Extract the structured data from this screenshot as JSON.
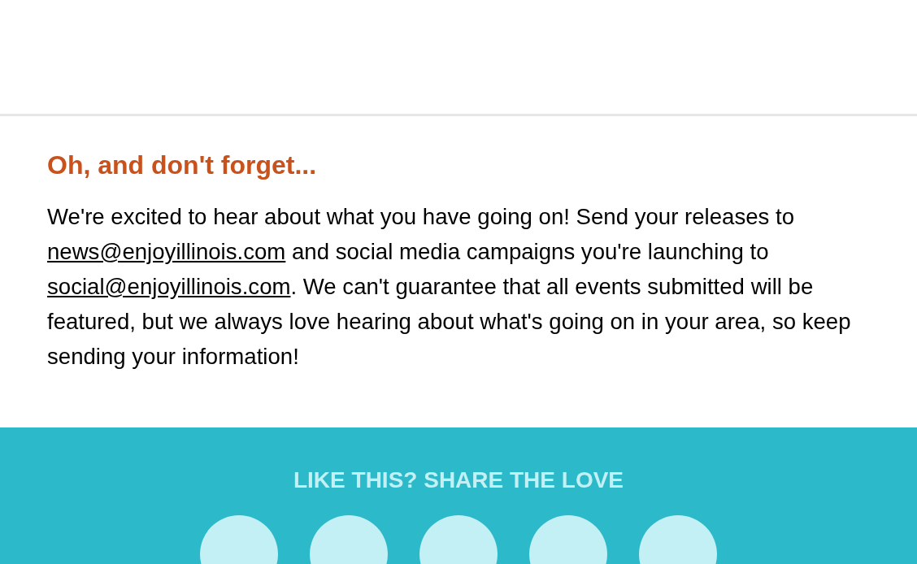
{
  "section": {
    "heading": "Oh, and don't forget...",
    "body": [
      {
        "kind": "text",
        "text": "We're excited to hear about what you have going on! Send your releases to "
      },
      {
        "kind": "link",
        "text": "news@enjoyillinois.com"
      },
      {
        "kind": "text",
        "text": " and social media campaigns you're launching to "
      },
      {
        "kind": "link",
        "text": "social@enjoyillinois.com"
      },
      {
        "kind": "text",
        "text": ". We can't guarantee that all events submitted will be featured, but we always love hearing about what's going on in your area, so keep sending your information!"
      }
    ]
  },
  "share": {
    "heading": "LIKE THIS? SHARE THE LOVE",
    "buttons": [
      {
        "kind": "share"
      },
      {
        "kind": "share"
      },
      {
        "kind": "share"
      },
      {
        "kind": "share"
      },
      {
        "kind": "share"
      }
    ]
  }
}
